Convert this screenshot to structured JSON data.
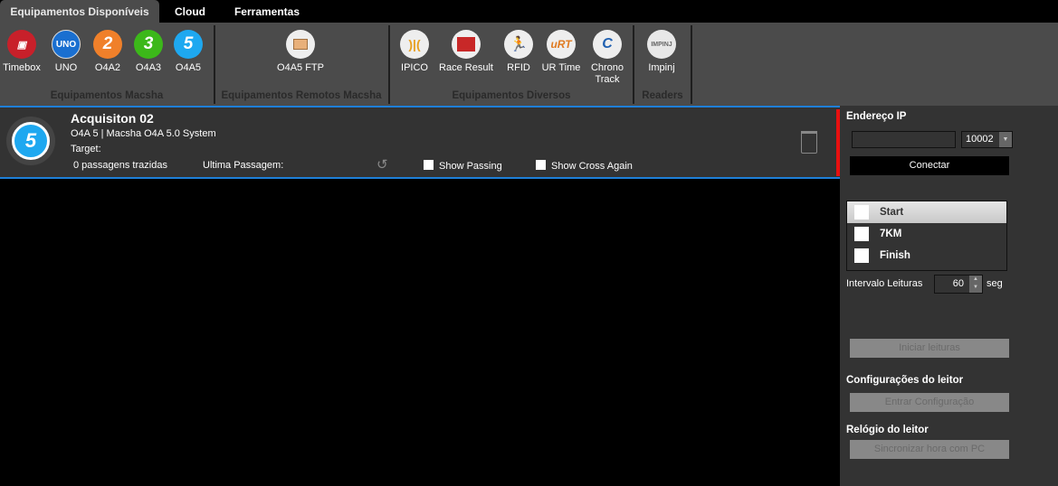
{
  "tabs": [
    {
      "label": "Equipamentos Disponíveis",
      "active": true
    },
    {
      "label": "Cloud"
    },
    {
      "label": "Ferramentas"
    }
  ],
  "ribbon": {
    "groups": [
      {
        "label": "Equipamentos Macsha",
        "items": [
          {
            "label": "Timebox",
            "icon": "timebox-logo",
            "color": "#c8202a"
          },
          {
            "label": "UNO",
            "icon": "uno-logo",
            "color": "#1a6fd0"
          },
          {
            "label": "O4A2",
            "icon": "2",
            "color": "#f0802a"
          },
          {
            "label": "O4A3",
            "icon": "3",
            "color": "#3cb81a"
          },
          {
            "label": "O4A5",
            "icon": "5",
            "color": "#1ea8f0"
          }
        ]
      },
      {
        "label": "Equipamentos Remotos Macsha",
        "items": [
          {
            "label": "O4A5 FTP",
            "icon": "folder-network-icon"
          }
        ]
      },
      {
        "label": "Equipamentos Diversos",
        "items": [
          {
            "label": "IPICO",
            "icon": "ipico-logo"
          },
          {
            "label": "Race Result",
            "icon": "race-result-logo"
          },
          {
            "label": "RFID",
            "icon": "runner-icon"
          },
          {
            "label": "UR Time",
            "icon": "urt-logo"
          },
          {
            "label": "Chrono Track",
            "icon": "chronotrack-logo"
          }
        ]
      },
      {
        "label": "Readers",
        "items": [
          {
            "label": "Impinj",
            "icon": "impinj-logo"
          }
        ]
      }
    ]
  },
  "device": {
    "name": "Acquisiton 02",
    "model": "O4A 5 | Macsha O4A 5.0 System",
    "target": "Target:",
    "passages": "0 passagens trazidas",
    "last_passage": "Ultima Passagem:",
    "show_passing": "Show Passing",
    "show_cross_again": "Show Cross Again",
    "status_color": "#e81010"
  },
  "panel": {
    "ip_title": "Endereço IP",
    "ip_value": "",
    "port": "10002",
    "connect": "Conectar",
    "points": [
      {
        "label": "Start",
        "selected": true
      },
      {
        "label": "7KM"
      },
      {
        "label": "Finish"
      }
    ],
    "interval_label": "Intervalo Leituras",
    "interval_value": "60",
    "interval_unit": "seg",
    "start_reading": "Iniciar leituras",
    "config_title": "Configurações do leitor",
    "config_button": "Entrar Configuração",
    "clock_title": "Relógio do leitor",
    "sync_button": "Sincronizar hora com PC"
  }
}
